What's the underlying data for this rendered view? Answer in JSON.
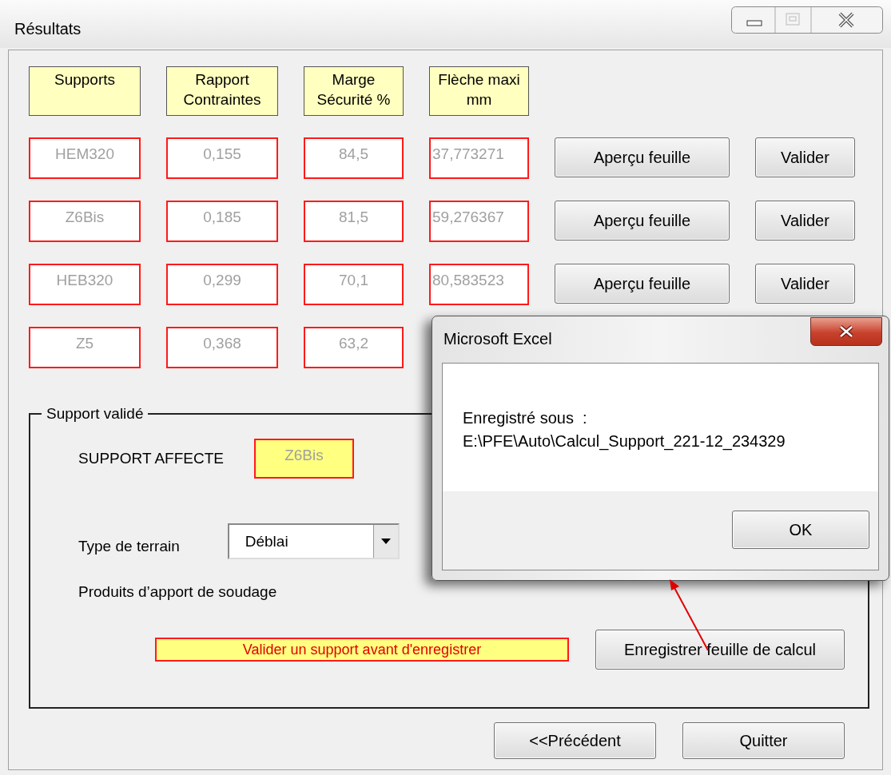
{
  "window": {
    "title": "Résultats"
  },
  "columns": [
    "Supports",
    "Rapport Contraintes",
    "Marge Sécurité %",
    "Flèche maxi mm"
  ],
  "rows": [
    {
      "cells": [
        "HEM320",
        "0,155",
        "84,5",
        "37,773271"
      ],
      "buttons": [
        "Aperçu feuille",
        "Valider"
      ]
    },
    {
      "cells": [
        "Z6Bis",
        "0,185",
        "81,5",
        "59,276367"
      ],
      "buttons": [
        "Aperçu feuille",
        "Valider"
      ]
    },
    {
      "cells": [
        "HEB320",
        "0,299",
        "70,1",
        "80,583523"
      ],
      "buttons": [
        "Aperçu feuille",
        "Valider"
      ]
    },
    {
      "cells": [
        "Z5",
        "0,368",
        "63,2"
      ],
      "buttons": []
    }
  ],
  "group": {
    "title": "Support validé",
    "support_label": "SUPPORT AFFECTE",
    "support_value": "Z6Bis",
    "terrain_label": "Type de terrain",
    "terrain_value": "Déblai",
    "soudage_label": "Produits d’apport de soudage",
    "message": "Valider un support avant d'enregistrer",
    "save_button": "Enregistrer feuille de calcul"
  },
  "buttons": [
    "<<Précédent",
    "Quitter"
  ],
  "dialog": {
    "title": "Microsoft Excel",
    "message_lines": [
      "Enregistré sous  :",
      "E:\\PFE\\Auto\\Calcul_Support_221-12_234329"
    ],
    "button": "OK"
  }
}
